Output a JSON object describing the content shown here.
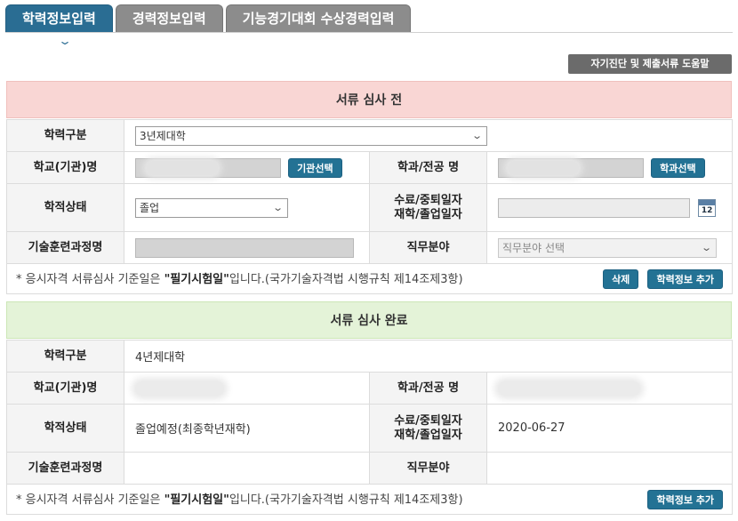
{
  "tabs": [
    {
      "label": "학력정보입력"
    },
    {
      "label": "경력정보입력"
    },
    {
      "label": "기능경기대회 수상경력입력"
    }
  ],
  "help_button": "자기진단 및 제출서류 도움말",
  "pending": {
    "header": "서류 심사 전",
    "edu_type_label": "학력구분",
    "edu_type_value": "3년제대학",
    "school_label": "학교(기관)명",
    "school_select_btn": "기관선택",
    "major_label": "학과/전공 명",
    "major_select_btn": "학과선택",
    "status_label": "학적상태",
    "status_value": "졸업",
    "date_label_1": "수료/중퇴일자",
    "date_label_2": "재학/졸업일자",
    "calendar_text": "12",
    "training_label": "기술훈련과정명",
    "job_label": "직무분야",
    "job_placeholder": "직무분야 선택",
    "note_prefix": "* 응시자격 서류심사 기준일은 ",
    "note_bold": "\"필기시험일\"",
    "note_suffix": "입니다.(국가기술자격법 시행규칙 제14조제3항)",
    "delete_btn": "삭제",
    "add_btn": "학력정보 추가"
  },
  "completed": {
    "header": "서류 심사 완료",
    "edu_type_label": "학력구분",
    "edu_type_value": "4년제대학",
    "school_label": "학교(기관)명",
    "major_label": "학과/전공 명",
    "status_label": "학적상태",
    "status_value": "졸업예정(최종학년재학)",
    "date_label_1": "수료/중퇴일자",
    "date_label_2": "재학/졸업일자",
    "date_value": "2020-06-27",
    "training_label": "기술훈련과정명",
    "job_label": "직무분야",
    "note_prefix": "* 응시자격 서류심사 기준일은 ",
    "note_bold": "\"필기시험일\"",
    "note_suffix": "입니다.(국가기술자격법 시행규칙 제14조제3항)",
    "add_btn": "학력정보 추가"
  }
}
